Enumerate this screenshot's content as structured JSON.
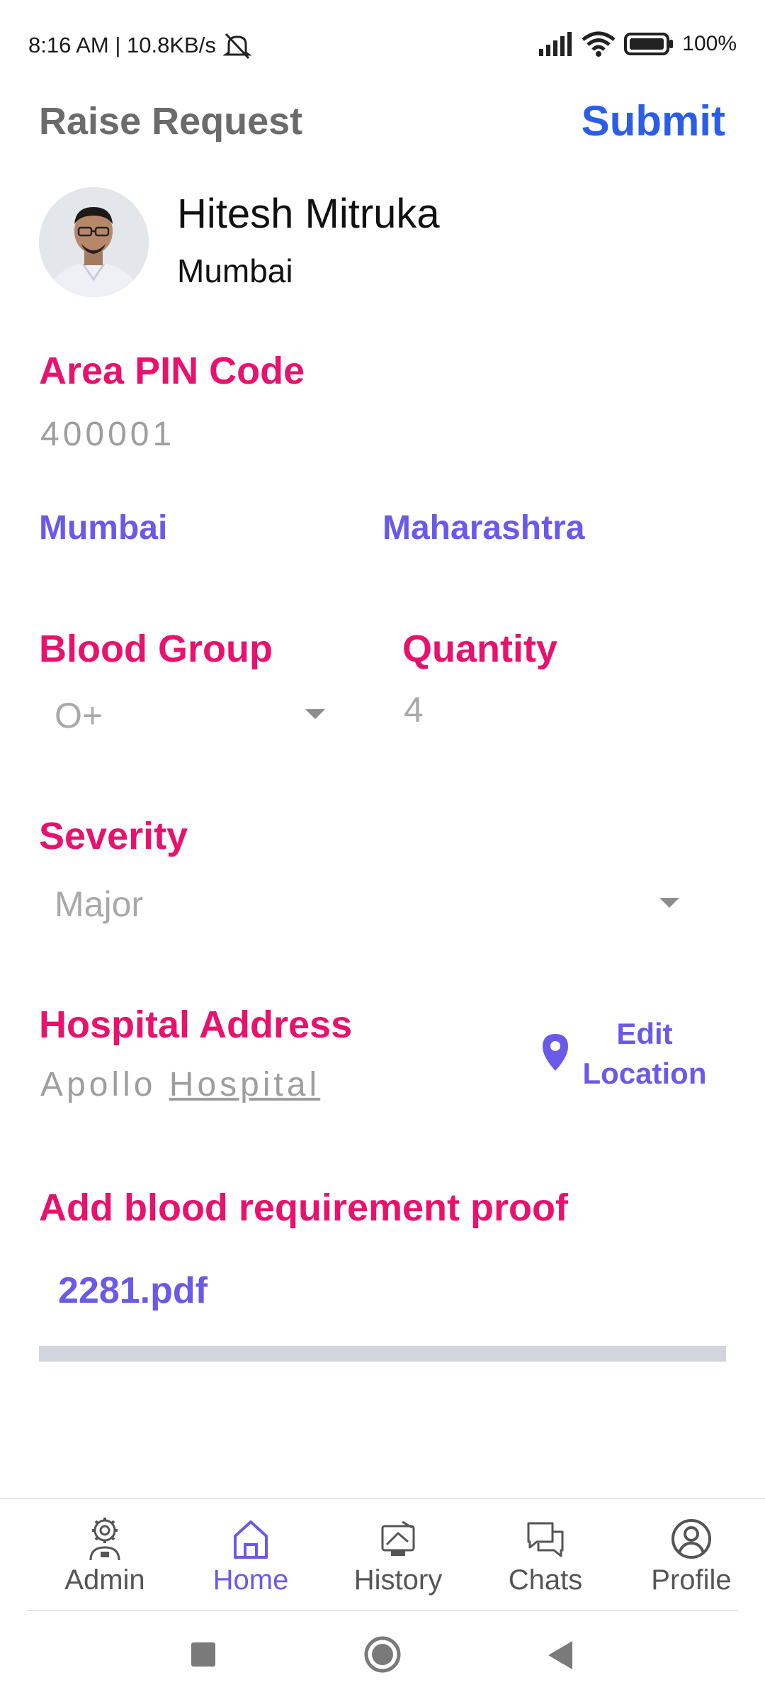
{
  "status_bar": {
    "time_speed": "8:16 AM | 10.8KB/s",
    "battery": "100%"
  },
  "header": {
    "title": "Raise Request",
    "submit_label": "Submit"
  },
  "user": {
    "name": "Hitesh Mitruka",
    "city": "Mumbai"
  },
  "pin": {
    "label": "Area PIN Code",
    "value": "400001",
    "city": "Mumbai",
    "state": "Maharashtra"
  },
  "blood_group": {
    "label": "Blood Group",
    "value": "O+"
  },
  "quantity": {
    "label": "Quantity",
    "value": "4"
  },
  "severity": {
    "label": "Severity",
    "value": "Major"
  },
  "hospital": {
    "label": "Hospital Address",
    "value_part1": "Apollo",
    "value_part2": "Hospital",
    "edit_line1": "Edit",
    "edit_line2": "Location"
  },
  "proof": {
    "label": "Add blood requirement proof",
    "file_name": "2281.pdf",
    "upload_progress": 1.0
  },
  "bottom_nav": {
    "items": [
      {
        "label": "Admin",
        "icon": "admin-gear-icon",
        "active": false
      },
      {
        "label": "Home",
        "icon": "home-icon",
        "active": true
      },
      {
        "label": "History",
        "icon": "history-icon",
        "active": false
      },
      {
        "label": "Chats",
        "icon": "chats-icon",
        "active": false
      },
      {
        "label": "Profile",
        "icon": "profile-icon",
        "active": false
      }
    ]
  },
  "colors": {
    "accent_pink": "#e8126e",
    "accent_purple": "#6a5ae8",
    "submit_blue": "#2b5ee6"
  }
}
